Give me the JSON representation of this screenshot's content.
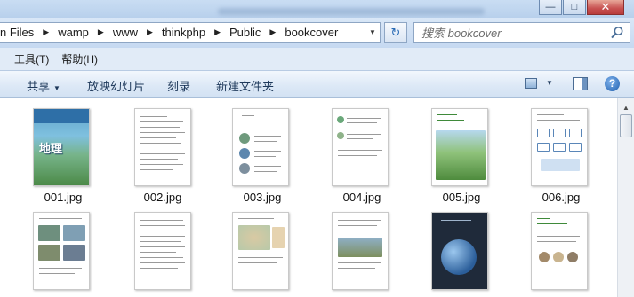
{
  "window": {
    "minimize_glyph": "—",
    "maximize_glyph": "□",
    "close_glyph": "✕"
  },
  "address": {
    "crumbs": [
      "n Files",
      "wamp",
      "www",
      "thinkphp",
      "Public",
      "bookcover"
    ],
    "separator": "▶",
    "dropdown_glyph": "▼",
    "refresh_glyph": "↻"
  },
  "search": {
    "placeholder": "搜索 bookcover"
  },
  "menu": {
    "items": [
      "工具(T)",
      "帮助(H)"
    ]
  },
  "toolbar": {
    "share_label": "共享",
    "caret_glyph": "▼",
    "slideshow_label": "放映幻灯片",
    "burn_label": "刻录",
    "new_folder_label": "新建文件夹",
    "help_glyph": "?"
  },
  "files": [
    {
      "name": "001.jpg",
      "kind": "cover"
    },
    {
      "name": "002.jpg",
      "kind": "text"
    },
    {
      "name": "003.jpg",
      "kind": "toc"
    },
    {
      "name": "004.jpg",
      "kind": "figure"
    },
    {
      "name": "005.jpg",
      "kind": "photo-page"
    },
    {
      "name": "006.jpg",
      "kind": "diagram"
    },
    {
      "name": "",
      "kind": "photos-grid"
    },
    {
      "name": "",
      "kind": "text"
    },
    {
      "name": "",
      "kind": "map"
    },
    {
      "name": "",
      "kind": "photo-text"
    },
    {
      "name": "",
      "kind": "space"
    },
    {
      "name": "",
      "kind": "planets"
    }
  ],
  "cover_title": "地理",
  "scrollbar": {
    "up_glyph": "▲"
  }
}
